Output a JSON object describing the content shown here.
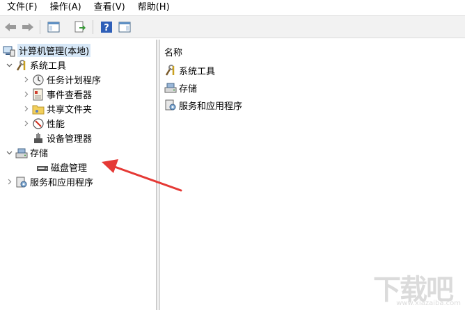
{
  "menu": [
    "文件(F)",
    "操作(A)",
    "查看(V)",
    "帮助(H)"
  ],
  "tree": {
    "root": "计算机管理(本地)",
    "system_tools": "系统工具",
    "task_scheduler": "任务计划程序",
    "event_viewer": "事件查看器",
    "shared_folders": "共享文件夹",
    "performance": "性能",
    "device_manager": "设备管理器",
    "storage": "存储",
    "disk_management": "磁盘管理",
    "services_apps": "服务和应用程序"
  },
  "list": {
    "header": "名称",
    "items": [
      "系统工具",
      "存储",
      "服务和应用程序"
    ]
  },
  "watermark": {
    "logo_text": "下载吧",
    "url": "www.xiazaiba.com"
  },
  "colors": {
    "selection": "#d6e7f7",
    "arrow": "#e53935",
    "help_icon": "#2f5fb8"
  }
}
